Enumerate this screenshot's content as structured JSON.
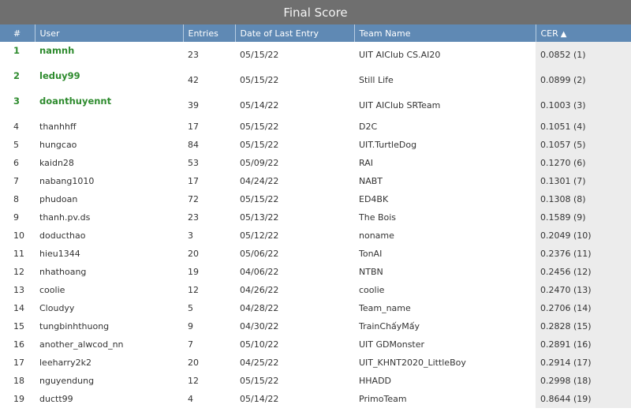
{
  "title": "Final Score",
  "columns": {
    "rank": "#",
    "user": "User",
    "entries": "Entries",
    "date": "Date of Last Entry",
    "team": "Team Name",
    "cer": "CER",
    "sort_icon": "sort-ascending-icon"
  },
  "rows": [
    {
      "rank": "1",
      "user": "namnh",
      "entries": "23",
      "date": "05/15/22",
      "team": "UIT AIClub CS.AI20",
      "cer": "0.0852 (1)"
    },
    {
      "rank": "2",
      "user": "leduy99",
      "entries": "42",
      "date": "05/15/22",
      "team": "Still Life",
      "cer": "0.0899 (2)"
    },
    {
      "rank": "3",
      "user": "doanthuyennt",
      "entries": "39",
      "date": "05/14/22",
      "team": "UIT AIClub SRTeam",
      "cer": "0.1003 (3)"
    },
    {
      "rank": "4",
      "user": "thanhhff",
      "entries": "17",
      "date": "05/15/22",
      "team": "D2C",
      "cer": "0.1051 (4)"
    },
    {
      "rank": "5",
      "user": "hungcao",
      "entries": "84",
      "date": "05/15/22",
      "team": "UIT.TurtleDog",
      "cer": "0.1057 (5)"
    },
    {
      "rank": "6",
      "user": "kaidn28",
      "entries": "53",
      "date": "05/09/22",
      "team": "RAI",
      "cer": "0.1270 (6)"
    },
    {
      "rank": "7",
      "user": "nabang1010",
      "entries": "17",
      "date": "04/24/22",
      "team": "NABT",
      "cer": "0.1301 (7)"
    },
    {
      "rank": "8",
      "user": "phudoan",
      "entries": "72",
      "date": "05/15/22",
      "team": "ED4BK",
      "cer": "0.1308 (8)"
    },
    {
      "rank": "9",
      "user": "thanh.pv.ds",
      "entries": "23",
      "date": "05/13/22",
      "team": "The Bois",
      "cer": "0.1589 (9)"
    },
    {
      "rank": "10",
      "user": "doducthao",
      "entries": "3",
      "date": "05/12/22",
      "team": "noname",
      "cer": "0.2049 (10)"
    },
    {
      "rank": "11",
      "user": "hieu1344",
      "entries": "20",
      "date": "05/06/22",
      "team": "TonAI",
      "cer": "0.2376 (11)"
    },
    {
      "rank": "12",
      "user": "nhathoang",
      "entries": "19",
      "date": "04/06/22",
      "team": "NTBN",
      "cer": "0.2456 (12)"
    },
    {
      "rank": "13",
      "user": "coolie",
      "entries": "12",
      "date": "04/26/22",
      "team": "coolie",
      "cer": "0.2470 (13)"
    },
    {
      "rank": "14",
      "user": "Cloudyy",
      "entries": "5",
      "date": "04/28/22",
      "team": "Team_name",
      "cer": "0.2706 (14)"
    },
    {
      "rank": "15",
      "user": "tungbinhthuong",
      "entries": "9",
      "date": "04/30/22",
      "team": "TrainChấyMấy",
      "cer": "0.2828 (15)"
    },
    {
      "rank": "16",
      "user": "another_alwcod_nn",
      "entries": "7",
      "date": "05/10/22",
      "team": "UIT GDMonster",
      "cer": "0.2891 (16)"
    },
    {
      "rank": "17",
      "user": "leeharry2k2",
      "entries": "20",
      "date": "04/25/22",
      "team": "UIT_KHNT2020_LittleBoy",
      "cer": "0.2914 (17)"
    },
    {
      "rank": "18",
      "user": "nguyendung",
      "entries": "12",
      "date": "05/15/22",
      "team": "HHADD",
      "cer": "0.2998 (18)"
    },
    {
      "rank": "19",
      "user": "ductt99",
      "entries": "4",
      "date": "05/14/22",
      "team": "PrimoTeam",
      "cer": "0.8644 (19)"
    }
  ]
}
